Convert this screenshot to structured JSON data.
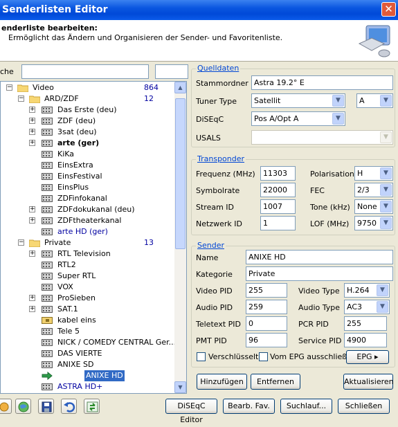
{
  "window": {
    "title": "Senderlisten Editor",
    "close": "✕"
  },
  "header": {
    "title": "enderliste bearbeiten:",
    "subtitle": "Ermöglicht das Ändern und Organisieren der Sender- und Favoritenliste."
  },
  "search": {
    "label": "che"
  },
  "tree": {
    "root": {
      "label": "Video",
      "count": "864"
    },
    "groups": [
      {
        "label": "ARD/ZDF",
        "count": "12",
        "items": [
          "Das Erste (deu)",
          "ZDF (deu)",
          "3sat (deu)",
          "arte (ger)",
          "KiKa",
          "EinsExtra",
          "EinsFestival",
          "EinsPlus",
          "ZDFinfokanal",
          "ZDFdokukanal (deu)",
          "ZDFtheaterkanal",
          "arte HD (ger)"
        ]
      },
      {
        "label": "Private",
        "count": "13",
        "items": [
          "RTL Television",
          "RTL2",
          "Super RTL",
          "VOX",
          "ProSieben",
          "SAT.1",
          "kabel eins",
          "Tele 5",
          "NICK / COMEDY CENTRAL Ger...",
          "DAS VIERTE",
          "ANIXE SD",
          "ANIXE HD",
          "ASTRA HD+"
        ]
      }
    ]
  },
  "quelldaten": {
    "legend": "Quelldaten",
    "stammordner_label": "Stammordner",
    "stammordner_value": "Astra 19.2° E",
    "tuner_label": "Tuner Type",
    "tuner_value": "Satellit",
    "tuner_slot": "A",
    "diseqc_label": "DiSEqC",
    "diseqc_value": "Pos A/Opt A",
    "usals_label": "USALS"
  },
  "transponder": {
    "legend": "Transponder",
    "freq_label": "Frequenz (MHz)",
    "freq_value": "11303",
    "pol_label": "Polarisation",
    "pol_value": "H",
    "sym_label": "Symbolrate",
    "sym_value": "22000",
    "fec_label": "FEC",
    "fec_value": "2/3",
    "sid_label": "Stream ID",
    "sid_value": "1007",
    "tone_label": "Tone (kHz)",
    "tone_value": "None",
    "nid_label": "Netzwerk ID",
    "nid_value": "1",
    "lof_label": "LOF (MHz)",
    "lof_value": "9750"
  },
  "sender": {
    "legend": "Sender",
    "name_label": "Name",
    "name_value": "ANIXE HD",
    "kat_label": "Kategorie",
    "kat_value": "Private",
    "vpid_label": "Video PID",
    "vpid_value": "255",
    "vtype_label": "Video Type",
    "vtype_value": "H.264",
    "apid_label": "Audio PID",
    "apid_value": "259",
    "atype_label": "Audio Type",
    "atype_value": "AC3",
    "tpid_label": "Teletext PID",
    "tpid_value": "0",
    "pcr_label": "PCR PID",
    "pcr_value": "255",
    "pmt_label": "PMT PID",
    "pmt_value": "96",
    "spid_label": "Service PID",
    "spid_value": "4900",
    "chk_encrypted": "Verschlüsselt",
    "chk_epg_excl": "Vom EPG ausschließen",
    "epg_btn": "EPG"
  },
  "actions": {
    "add": "Hinzufügen",
    "remove": "Entfernen",
    "refresh": "Aktualisieren"
  },
  "bottom": {
    "diseqc_editor": "DiSEqC Editor",
    "edit_fav": "Bearb. Fav.",
    "search": "Suchlauf...",
    "close": "Schließen"
  }
}
